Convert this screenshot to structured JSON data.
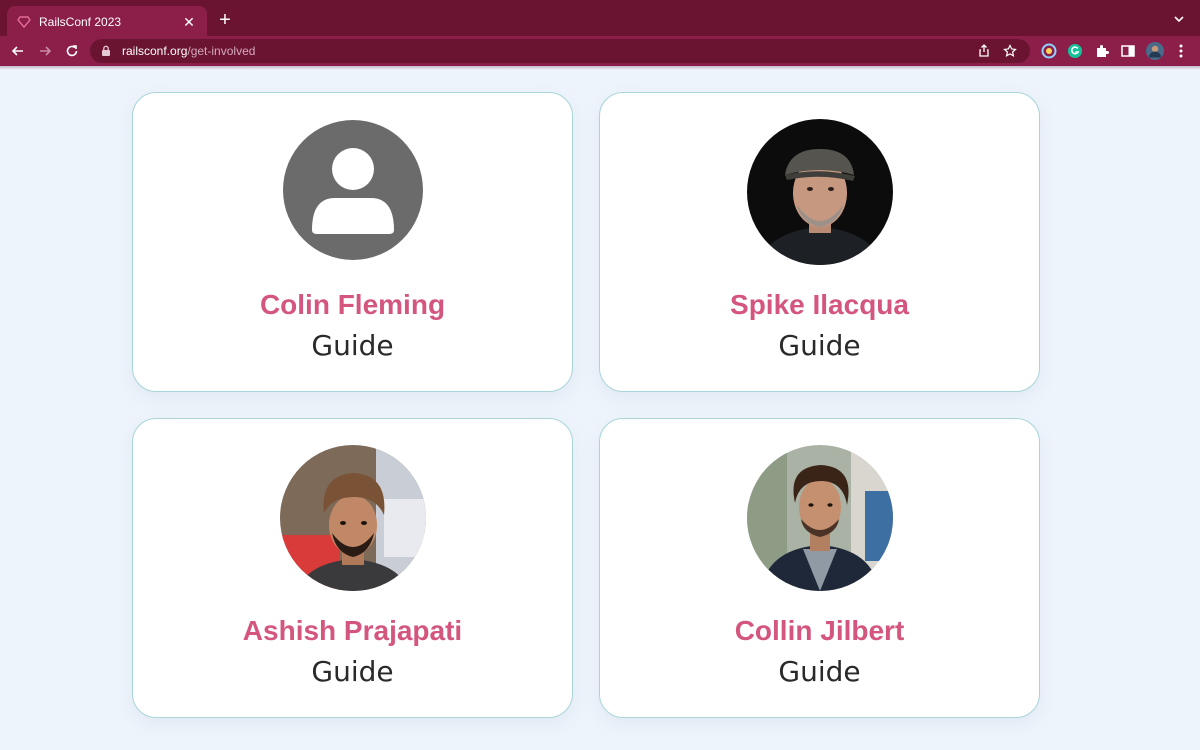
{
  "browser": {
    "tab_title": "RailsConf 2023",
    "url_host": "railsconf.org",
    "url_path": "/get-involved"
  },
  "colors": {
    "chrome_dark": "#6a1432",
    "chrome": "#8c1e4a",
    "accent": "#d4567f",
    "card_border": "#a8d5d8",
    "page_bg": "#eef4fb"
  },
  "people": [
    {
      "name": "Colin Fleming",
      "role": "Guide",
      "avatar": "default-user-icon"
    },
    {
      "name": "Spike Ilacqua",
      "role": "Guide",
      "avatar": "photo"
    },
    {
      "name": "Ashish Prajapati",
      "role": "Guide",
      "avatar": "photo"
    },
    {
      "name": "Collin Jilbert",
      "role": "Guide",
      "avatar": "photo"
    }
  ]
}
